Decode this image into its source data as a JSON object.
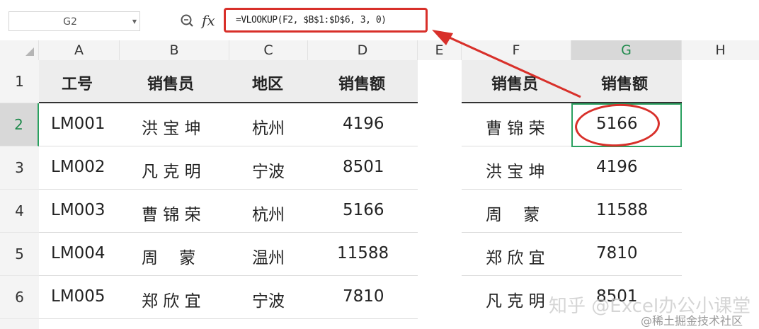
{
  "formula_bar": {
    "name_box": "G2",
    "fx_label": "fx",
    "formula": "=VLOOKUP(F2, $B$1:$D$6, 3, 0)"
  },
  "columns": [
    "A",
    "B",
    "C",
    "D",
    "E",
    "F",
    "G",
    "H"
  ],
  "rows": [
    "1",
    "2",
    "3",
    "4",
    "5",
    "6"
  ],
  "selected_cell": "G2",
  "left_table": {
    "headers": [
      "工号",
      "销售员",
      "地区",
      "销售额"
    ],
    "rows": [
      [
        "LM001",
        "洪 宝 坤",
        "杭州",
        "4196"
      ],
      [
        "LM002",
        "凡 克 明",
        "宁波",
        "8501"
      ],
      [
        "LM003",
        "曹 锦 荣",
        "杭州",
        "5166"
      ],
      [
        "LM004",
        "周　 蒙",
        "温州",
        "11588"
      ],
      [
        "LM005",
        "郑 欣 宜",
        "宁波",
        "7810"
      ]
    ]
  },
  "right_table": {
    "headers": [
      "销售员",
      "销售额"
    ],
    "rows": [
      [
        "曹 锦 荣",
        "5166"
      ],
      [
        "洪 宝 坤",
        "4196"
      ],
      [
        "周　 蒙",
        "11588"
      ],
      [
        "郑 欣 宜",
        "7810"
      ],
      [
        "凡 克 明",
        "8501"
      ]
    ]
  },
  "watermarks": {
    "zhihu": "知乎 @Excel办公小课堂",
    "juejin": "@稀土掘金技术社区"
  },
  "colors": {
    "accent_red": "#d8302a",
    "selection_green": "#2aa060"
  }
}
